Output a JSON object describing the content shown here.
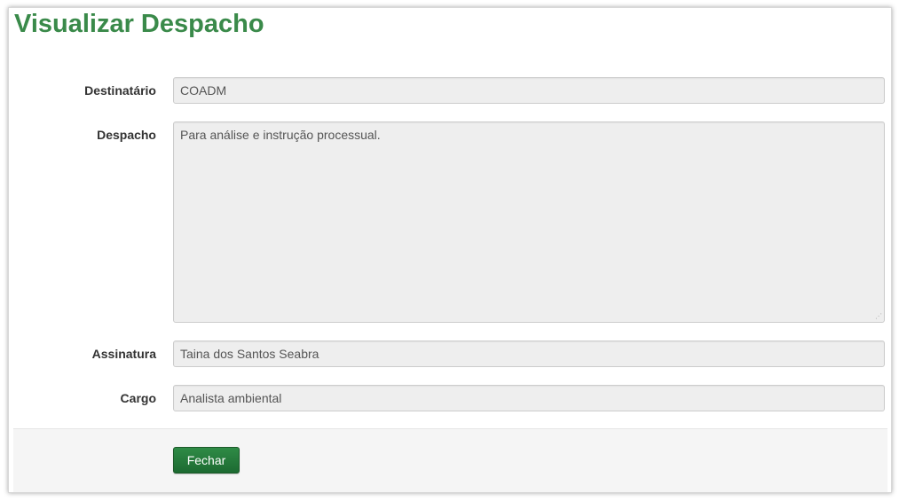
{
  "dialog": {
    "title": "Visualizar Despacho"
  },
  "form": {
    "destinatario": {
      "label": "Destinatário",
      "value": "COADM"
    },
    "despacho": {
      "label": "Despacho",
      "value": "Para análise e instrução processual."
    },
    "assinatura": {
      "label": "Assinatura",
      "value": "Taina dos Santos Seabra"
    },
    "cargo": {
      "label": "Cargo",
      "value": "Analista ambiental"
    }
  },
  "footer": {
    "close_label": "Fechar"
  },
  "colors": {
    "title": "#3a8a4a",
    "button": "#1c6a31",
    "field_bg": "#eeeeee",
    "footer_bg": "#f5f5f5"
  }
}
